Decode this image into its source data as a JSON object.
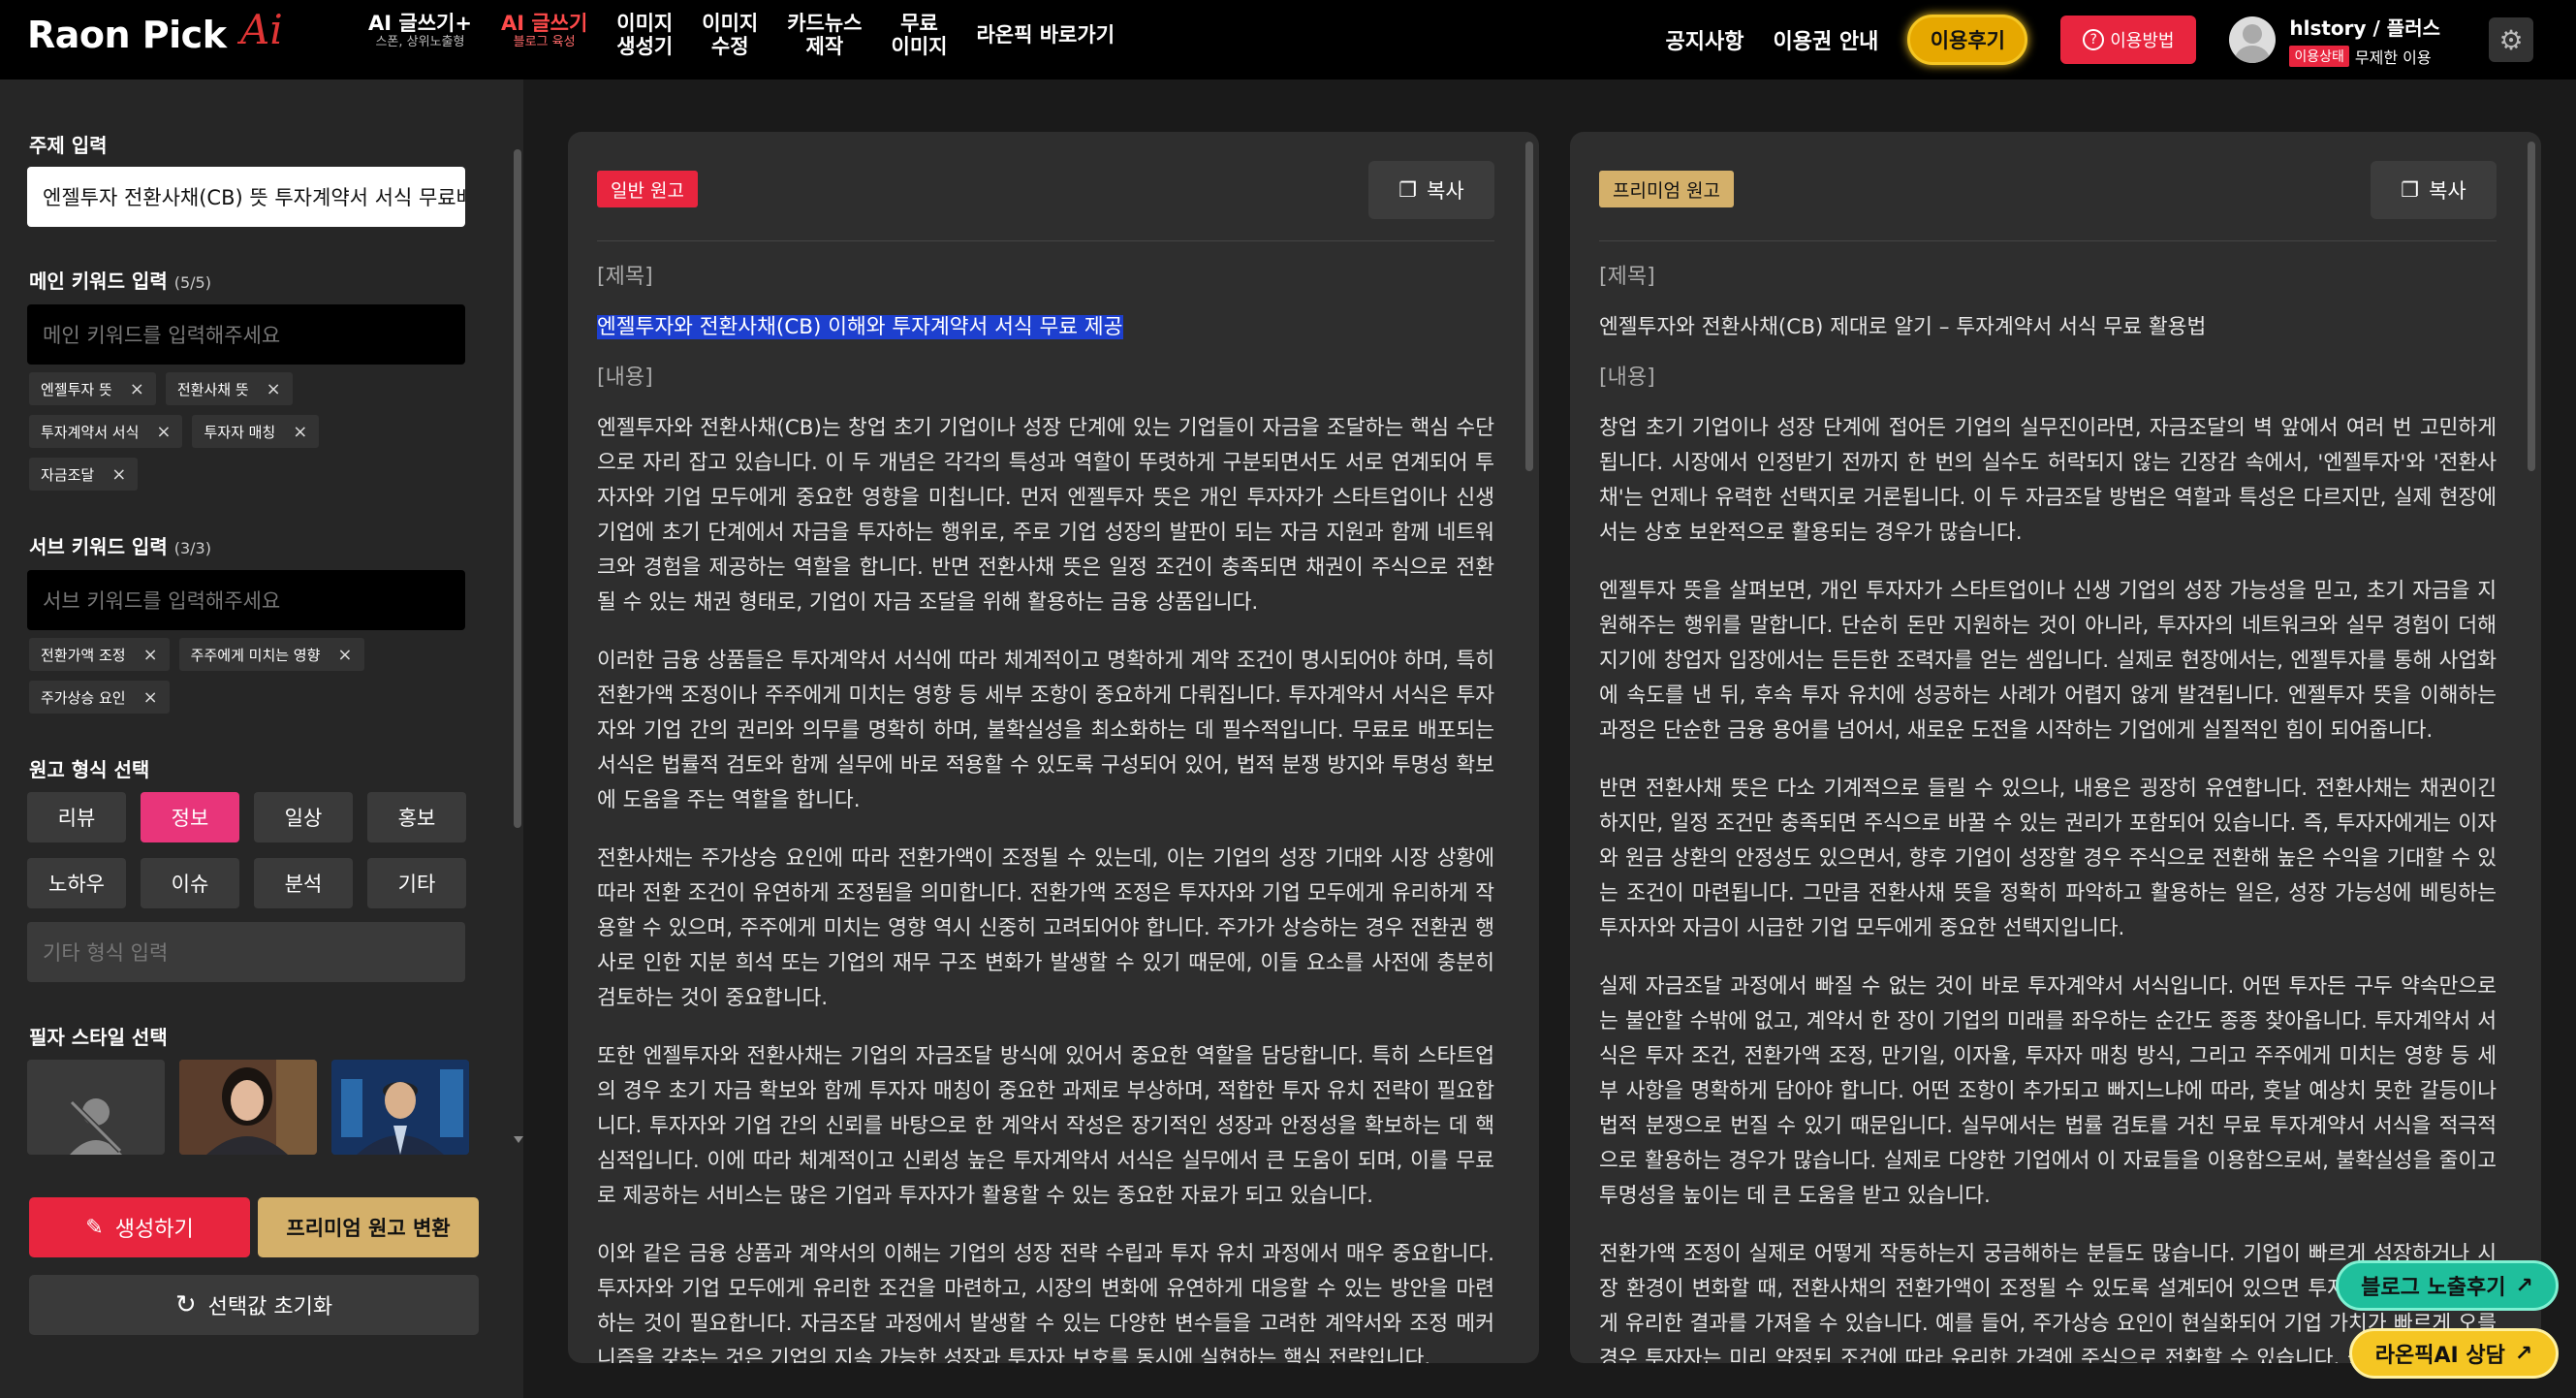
{
  "header": {
    "logo_text": "Raon Pick",
    "logo_ai": "Ai",
    "nav": [
      {
        "label": "AI 글쓰기+",
        "sub": "스폰, 상위노출형",
        "active": false
      },
      {
        "label": "AI 글쓰기",
        "sub": "블로그 육성",
        "active": true
      },
      {
        "label": "이미지",
        "label2": "생성기"
      },
      {
        "label": "이미지",
        "label2": "수정"
      },
      {
        "label": "카드뉴스",
        "label2": "제작"
      },
      {
        "label": "무료",
        "label2": "이미지"
      },
      {
        "label": "라온픽 바로가기"
      }
    ],
    "notice": "공지사항",
    "pricing": "이용권 안내",
    "review_button": "이용후기",
    "howto_button": "이용방법",
    "user_name": "hlstory / 플러스",
    "user_status_label": "이용상태",
    "user_status_value": "무제한 이용"
  },
  "sidebar": {
    "topic_label": "주제 입력",
    "topic_value": "엔젤투자 전환사채(CB) 뜻 투자계약서 서식 무료배",
    "main_kw_label": "메인 키워드 입력",
    "main_kw_count": "(5/5)",
    "main_kw_placeholder": "메인 키워드를 입력해주세요",
    "main_keywords": [
      "엔젤투자 뜻",
      "전환사채 뜻",
      "투자계약서 서식",
      "투자자 매칭",
      "자금조달"
    ],
    "sub_kw_label": "서브 키워드 입력",
    "sub_kw_count": "(3/3)",
    "sub_kw_placeholder": "서브 키워드를 입력해주세요",
    "sub_keywords": [
      "전환가액 조정",
      "주주에게 미치는 영향",
      "주가상승 요인"
    ],
    "format_label": "원고 형식 선택",
    "formats": [
      "리뷰",
      "정보",
      "일상",
      "홍보",
      "노하우",
      "이슈",
      "분석",
      "기타"
    ],
    "selected_format": "정보",
    "format_other_placeholder": "기타 형식 입력",
    "style_label": "필자 스타일 선택",
    "generate_button": "생성하기",
    "premium_button": "프리미엄 원고 변환",
    "reset_button": "선택값 초기화"
  },
  "panel_left": {
    "badge": "일반 원고",
    "copy": "복사",
    "title_label": "[제목]",
    "title": "엔젤투자와 전환사채(CB) 이해와 투자계약서 서식 무료 제공",
    "content_label": "[내용]",
    "paragraphs": [
      "엔젤투자와 전환사채(CB)는 창업 초기 기업이나 성장 단계에 있는 기업들이 자금을 조달하는 핵심 수단으로 자리 잡고 있습니다. 이 두 개념은 각각의 특성과 역할이 뚜렷하게 구분되면서도 서로 연계되어 투자자와 기업 모두에게 중요한 영향을 미칩니다. 먼저 엔젤투자 뜻은 개인 투자자가 스타트업이나 신생 기업에 초기 단계에서 자금을 투자하는 행위로, 주로 기업 성장의 발판이 되는 자금 지원과 함께 네트워크와 경험을 제공하는 역할을 합니다. 반면 전환사채 뜻은 일정 조건이 충족되면 채권이 주식으로 전환될 수 있는 채권 형태로, 기업이 자금 조달을 위해 활용하는 금융 상품입니다.",
      "이러한 금융 상품들은 투자계약서 서식에 따라 체계적이고 명확하게 계약 조건이 명시되어야 하며, 특히 전환가액 조정이나 주주에게 미치는 영향 등 세부 조항이 중요하게 다뤄집니다. 투자계약서 서식은 투자자와 기업 간의 권리와 의무를 명확히 하며, 불확실성을 최소화하는 데 필수적입니다. 무료로 배포되는 서식은 법률적 검토와 함께 실무에 바로 적용할 수 있도록 구성되어 있어, 법적 분쟁 방지와 투명성 확보에 도움을 주는 역할을 합니다.",
      "전환사채는 주가상승 요인에 따라 전환가액이 조정될 수 있는데, 이는 기업의 성장 기대와 시장 상황에 따라 전환 조건이 유연하게 조정됨을 의미합니다. 전환가액 조정은 투자자와 기업 모두에게 유리하게 작용할 수 있으며, 주주에게 미치는 영향 역시 신중히 고려되어야 합니다. 주가가 상승하는 경우 전환권 행사로 인한 지분 희석 또는 기업의 재무 구조 변화가 발생할 수 있기 때문에, 이들 요소를 사전에 충분히 검토하는 것이 중요합니다.",
      "또한 엔젤투자와 전환사채는 기업의 자금조달 방식에 있어서 중요한 역할을 담당합니다. 특히 스타트업의 경우 초기 자금 확보와 함께 투자자 매칭이 중요한 과제로 부상하며, 적합한 투자 유치 전략이 필요합니다. 투자자와 기업 간의 신뢰를 바탕으로 한 계약서 작성은 장기적인 성장과 안정성을 확보하는 데 핵심적입니다. 이에 따라 체계적이고 신뢰성 높은 투자계약서 서식은 실무에서 큰 도움이 되며, 이를 무료로 제공하는 서비스는 많은 기업과 투자자가 활용할 수 있는 중요한 자료가 되고 있습니다.",
      "이와 같은 금융 상품과 계약서의 이해는 기업의 성장 전략 수립과 투자 유치 과정에서 매우 중요합니다. 투자자와 기업 모두에게 유리한 조건을 마련하고, 시장의 변화에 유연하게 대응할 수 있는 방안을 마련하는 것이 필요합니다. 자금조달 과정에서 발생할 수 있는 다양한 변수들을 고려한 계약서와 조정 메커니즘을 갖추는 것은 기업의 지속 가능한 성장과 투자자 보호를 동시에 실현하는 핵심 전략입니다."
    ]
  },
  "panel_right": {
    "badge": "프리미엄 원고",
    "copy": "복사",
    "title_label": "[제목]",
    "title": "엔젤투자와 전환사채(CB) 제대로 알기 – 투자계약서 서식 무료 활용법",
    "content_label": "[내용]",
    "paragraphs": [
      "창업 초기 기업이나 성장 단계에 접어든 기업의 실무진이라면, 자금조달의 벽 앞에서 여러 번 고민하게 됩니다. 시장에서 인정받기 전까지 한 번의 실수도 허락되지 않는 긴장감 속에서, '엔젤투자'와 '전환사채'는 언제나 유력한 선택지로 거론됩니다. 이 두 자금조달 방법은 역할과 특성은 다르지만, 실제 현장에서는 상호 보완적으로 활용되는 경우가 많습니다.",
      "엔젤투자 뜻을 살펴보면, 개인 투자자가 스타트업이나 신생 기업의 성장 가능성을 믿고, 초기 자금을 지원해주는 행위를 말합니다. 단순히 돈만 지원하는 것이 아니라, 투자자의 네트워크와 실무 경험이 더해지기에 창업자 입장에서는 든든한 조력자를 얻는 셈입니다. 실제로 현장에서는, 엔젤투자를 통해 사업화에 속도를 낸 뒤, 후속 투자 유치에 성공하는 사례가 어렵지 않게 발견됩니다. 엔젤투자 뜻을 이해하는 과정은 단순한 금융 용어를 넘어서, 새로운 도전을 시작하는 기업에게 실질적인 힘이 되어줍니다.",
      "반면 전환사채 뜻은 다소 기계적으로 들릴 수 있으나, 내용은 굉장히 유연합니다. 전환사채는 채권이긴 하지만, 일정 조건만 충족되면 주식으로 바꿀 수 있는 권리가 포함되어 있습니다. 즉, 투자자에게는 이자와 원금 상환의 안정성도 있으면서, 향후 기업이 성장할 경우 주식으로 전환해 높은 수익을 기대할 수 있는 조건이 마련됩니다. 그만큼 전환사채 뜻을 정확히 파악하고 활용하는 일은, 성장 가능성에 베팅하는 투자자와 자금이 시급한 기업 모두에게 중요한 선택지입니다.",
      "실제 자금조달 과정에서 빠질 수 없는 것이 바로 투자계약서 서식입니다. 어떤 투자든 구두 약속만으로는 불안할 수밖에 없고, 계약서 한 장이 기업의 미래를 좌우하는 순간도 종종 찾아옵니다. 투자계약서 서식은 투자 조건, 전환가액 조정, 만기일, 이자율, 투자자 매칭 방식, 그리고 주주에게 미치는 영향 등 세부 사항을 명확하게 담아야 합니다. 어떤 조항이 추가되고 빠지느냐에 따라, 훗날 예상치 못한 갈등이나 법적 분쟁으로 번질 수 있기 때문입니다. 실무에서는 법률 검토를 거친 무료 투자계약서 서식을 적극적으로 활용하는 경우가 많습니다. 실제로 다양한 기업에서 이 자료들을 이용함으로써, 불확실성을 줄이고 투명성을 높이는 데 큰 도움을 받고 있습니다.",
      "전환가액 조정이 실제로 어떻게 작동하는지 궁금해하는 분들도 많습니다. 기업이 빠르게 성장하거나 시장 환경이 변화할 때, 전환사채의 전환가액이 조정될 수 있도록 설계되어 있으면 투자자와 기업 모두에게 유리한 결과를 가져올 수 있습니다. 예를 들어, 주가상승 요인이 현실화되어 기업 가치가 빠르게 오를 경우 투자자는 미리 약정된 조건에 따라 유리한 가격에 주식으로 전환할 수 있습니다. 물론 이 과정에서 주주에게 미치는 영향도 함께 고려되어야 합니다."
    ]
  },
  "floating": {
    "blog_review": "블로그 노출후기",
    "consult": "라온픽AI 상담"
  },
  "colors": {
    "accent_red": "#e8253e",
    "accent_pink": "#e8357a",
    "gold": "#d4b06a",
    "yellow": "#f5c623",
    "teal": "#1fbf9c"
  }
}
